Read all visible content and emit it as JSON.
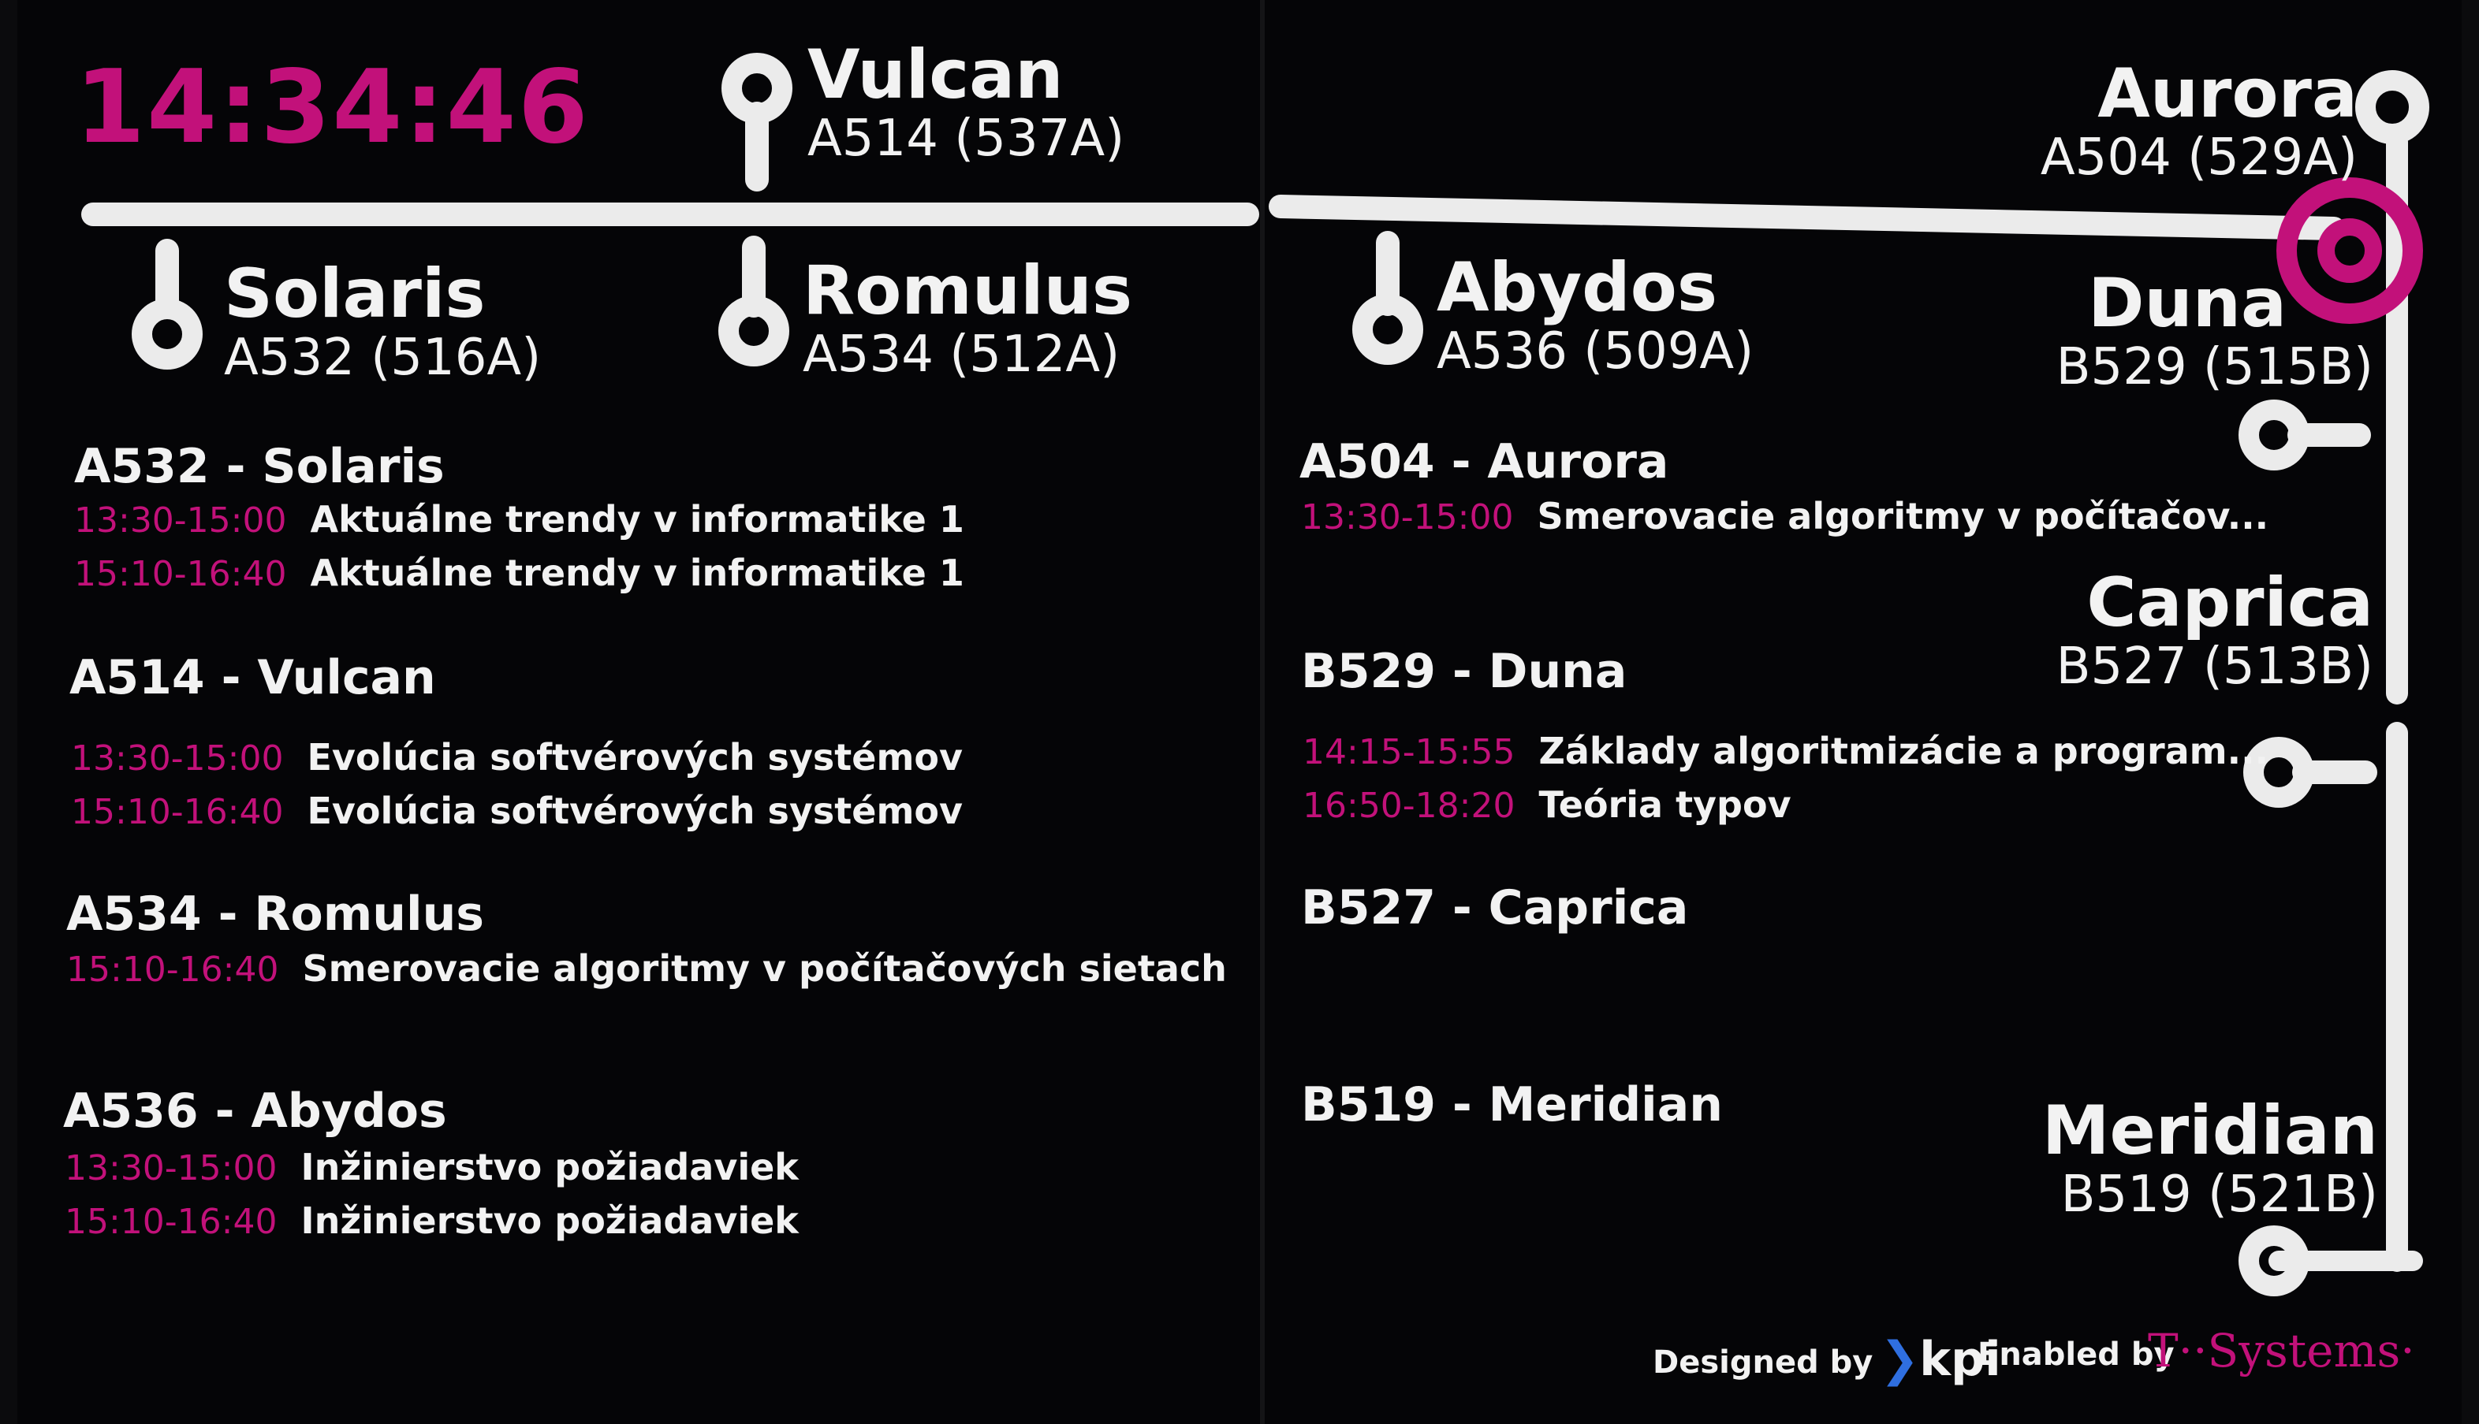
{
  "clock": "14:34:46",
  "rooms_top_left": [
    {
      "name": "Solaris",
      "code": "A532 (516A)"
    },
    {
      "name": "Vulcan",
      "code": "A514 (537A)"
    },
    {
      "name": "Romulus",
      "code": "A534 (512A)"
    }
  ],
  "rooms_top_right": [
    {
      "name": "Abydos",
      "code": "A536 (509A)"
    },
    {
      "name": "Aurora",
      "code": "A504 (529A)"
    },
    {
      "name": "Duna",
      "code": "B529 (515B)"
    },
    {
      "name": "Caprica",
      "code": "B527 (513B)"
    },
    {
      "name": "Meridian",
      "code": "B519 (521B)"
    }
  ],
  "schedule_left": [
    {
      "title": "A532 - Solaris",
      "rows": [
        {
          "time": "13:30-15:00",
          "course": "Aktuálne trendy v informatike 1"
        },
        {
          "time": "15:10-16:40",
          "course": "Aktuálne trendy v informatike 1"
        }
      ]
    },
    {
      "title": "A514 - Vulcan",
      "rows": [
        {
          "time": "13:30-15:00",
          "course": "Evolúcia softvérových systémov"
        },
        {
          "time": "15:10-16:40",
          "course": "Evolúcia softvérových systémov"
        }
      ]
    },
    {
      "title": "A534 - Romulus",
      "rows": [
        {
          "time": "15:10-16:40",
          "course": "Smerovacie algoritmy v počítačových sietach"
        }
      ]
    },
    {
      "title": "A536 - Abydos",
      "rows": [
        {
          "time": "13:30-15:00",
          "course": "Inžinierstvo požiadaviek"
        },
        {
          "time": "15:10-16:40",
          "course": "Inžinierstvo požiadaviek"
        }
      ]
    }
  ],
  "schedule_right": [
    {
      "title": "A504 - Aurora",
      "rows": [
        {
          "time": "13:30-15:00",
          "course": "Smerovacie algoritmy v počítačov..."
        }
      ]
    },
    {
      "title": "B529 - Duna",
      "rows": [
        {
          "time": "14:15-15:55",
          "course": "Základy algoritmizácie a program..."
        },
        {
          "time": "16:50-18:20",
          "course": "Teória typov"
        }
      ]
    },
    {
      "title": "B527 - Caprica",
      "rows": []
    },
    {
      "title": "B519 - Meridian",
      "rows": []
    }
  ],
  "footer": {
    "designed_by": "Designed by",
    "designed_logo": "kpi",
    "enabled_by": "Enabled by",
    "enabled_logo": "T··Systems·"
  },
  "colors": {
    "accent": "#c2117a",
    "line": "#ebebeb",
    "background": "#050507"
  },
  "icons": [
    "room-pin-icon",
    "you-are-here-icon",
    "kpi-chevron-icon"
  ]
}
